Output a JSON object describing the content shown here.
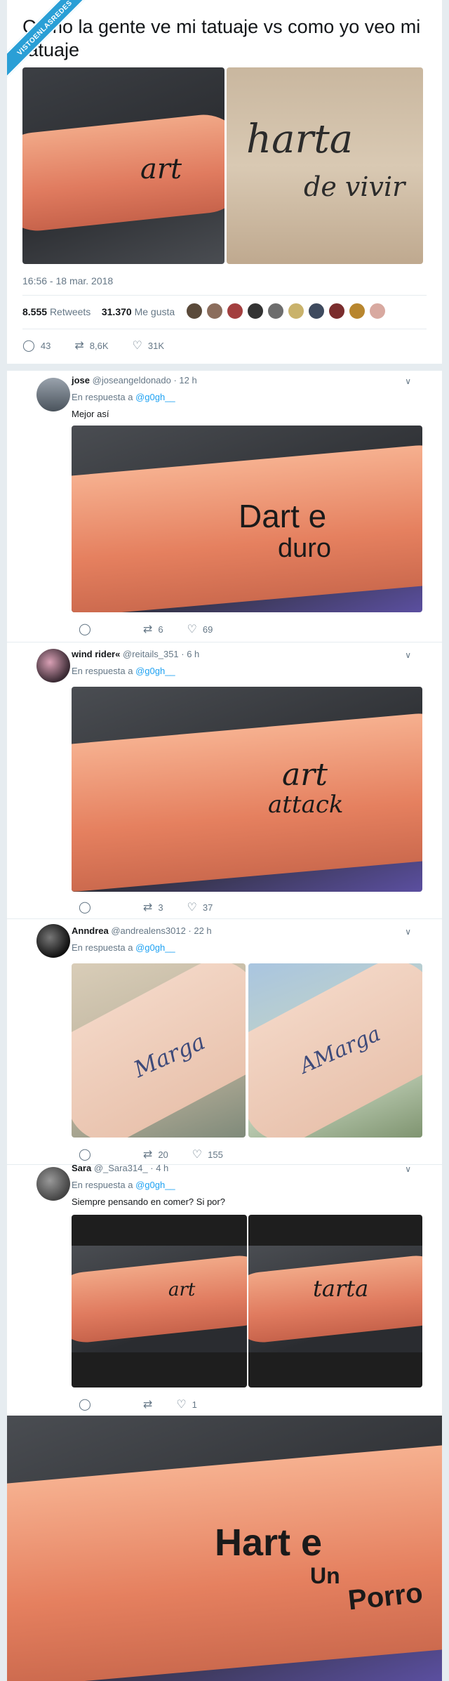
{
  "watermark": "VISTOENLASREDES",
  "headline": "Como la gente ve mi tatuaje vs como yo veo mi tatuaje",
  "main": {
    "images": [
      {
        "tattoo_line1": "art"
      },
      {
        "tattoo_line1": "harta",
        "tattoo_line2": "de vivir"
      }
    ],
    "timestamp": "16:56 - 18 mar. 2018",
    "retweets_count": "8.555",
    "retweets_label": "Retweets",
    "likes_count": "31.370",
    "likes_label": "Me gusta",
    "replies": "43",
    "retweets_short": "8,6K",
    "likes_short": "31K"
  },
  "replies": [
    {
      "name": "jose",
      "handle": "@joseangeldonado · 12 h",
      "replying_prefix": "En respuesta a",
      "replying_to": "@g0gh__",
      "text": "Mejor así",
      "tattoo_main": "Dart e",
      "tattoo_sub": "duro",
      "retweets": "6",
      "likes": "69"
    },
    {
      "name": "wind rider«",
      "handle": "@reitails_351 · 6 h",
      "replying_prefix": "En respuesta a",
      "replying_to": "@g0gh__",
      "tattoo_main": "art",
      "tattoo_sub": "attack",
      "retweets": "3",
      "likes": "37"
    },
    {
      "name": "Anndrea",
      "handle": "@andrealens3012 · 22 h",
      "replying_prefix": "En respuesta a",
      "replying_to": "@g0gh__",
      "tattoo_left": "Marga",
      "tattoo_right": "AMarga",
      "replies": "",
      "retweets": "20",
      "likes": "155"
    },
    {
      "name": "Sara",
      "handle": "@_Sara314_ · 4 h",
      "replying_prefix": "En respuesta a",
      "replying_to": "@g0gh__",
      "text": "Siempre pensando en comer? Si por?",
      "tattoo_left": "art",
      "tattoo_right": "tarta",
      "likes": "1"
    }
  ],
  "final_image": {
    "tattoo_main": "Hart e",
    "tattoo_sub1": "Un",
    "tattoo_sub2": "Porro"
  },
  "colors": {
    "accent": "#1da1f2",
    "muted": "#657786",
    "skin": "#e8836a",
    "bg": "#e6ecf0"
  },
  "icons": {
    "reply": "reply-icon",
    "retweet": "retweet-icon",
    "like": "heart-icon",
    "caret": "chevron-down-icon"
  }
}
